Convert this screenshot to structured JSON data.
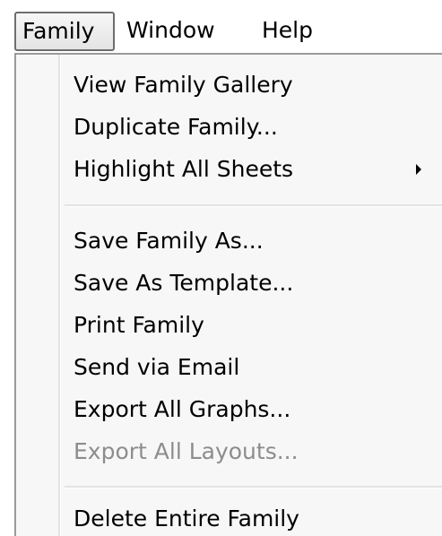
{
  "menubar": {
    "items": [
      {
        "label": "Family",
        "active": true
      },
      {
        "label": "Window",
        "active": false
      },
      {
        "label": "Help",
        "active": false
      }
    ]
  },
  "family_menu": {
    "groups": [
      [
        {
          "label": "View Family Gallery",
          "enabled": true
        },
        {
          "label": "Duplicate Family...",
          "enabled": true
        },
        {
          "label": "Highlight All Sheets",
          "enabled": true,
          "submenu": true
        }
      ],
      [
        {
          "label": "Save Family As...",
          "enabled": true
        },
        {
          "label": "Save As Template...",
          "enabled": true
        },
        {
          "label": "Print Family",
          "enabled": true
        },
        {
          "label": "Send via Email",
          "enabled": true
        },
        {
          "label": "Export All Graphs...",
          "enabled": true
        },
        {
          "label": "Export All Layouts...",
          "enabled": false
        }
      ],
      [
        {
          "label": "Delete Entire Family",
          "enabled": true
        }
      ]
    ]
  },
  "colors": {
    "menu_background": "#f7f7f7",
    "disabled_text": "#8d8d8d",
    "text": "#000000"
  },
  "icons": {
    "submenu_indicator": "chevron-right-icon"
  }
}
